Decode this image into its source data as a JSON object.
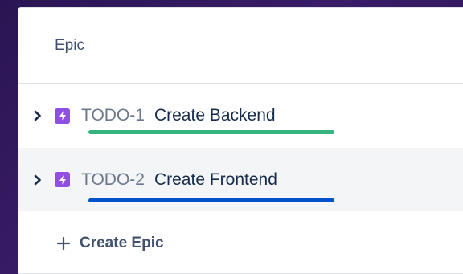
{
  "header": {
    "title": "Epic"
  },
  "rows": [
    {
      "key": "TODO-1",
      "summary": "Create Backend",
      "underline_color": "#36b37e"
    },
    {
      "key": "TODO-2",
      "summary": "Create Frontend",
      "underline_color": "#0052cc"
    }
  ],
  "icons": {
    "expand": "chevron-right-icon",
    "epic": "lightning-bolt-icon",
    "create": "plus-icon"
  },
  "create_epic": {
    "label": "Create Epic"
  },
  "colors": {
    "epic_icon_bg": "#904ee2",
    "panel_bg": "#ffffff",
    "alt_row_bg": "#f4f5f7"
  }
}
